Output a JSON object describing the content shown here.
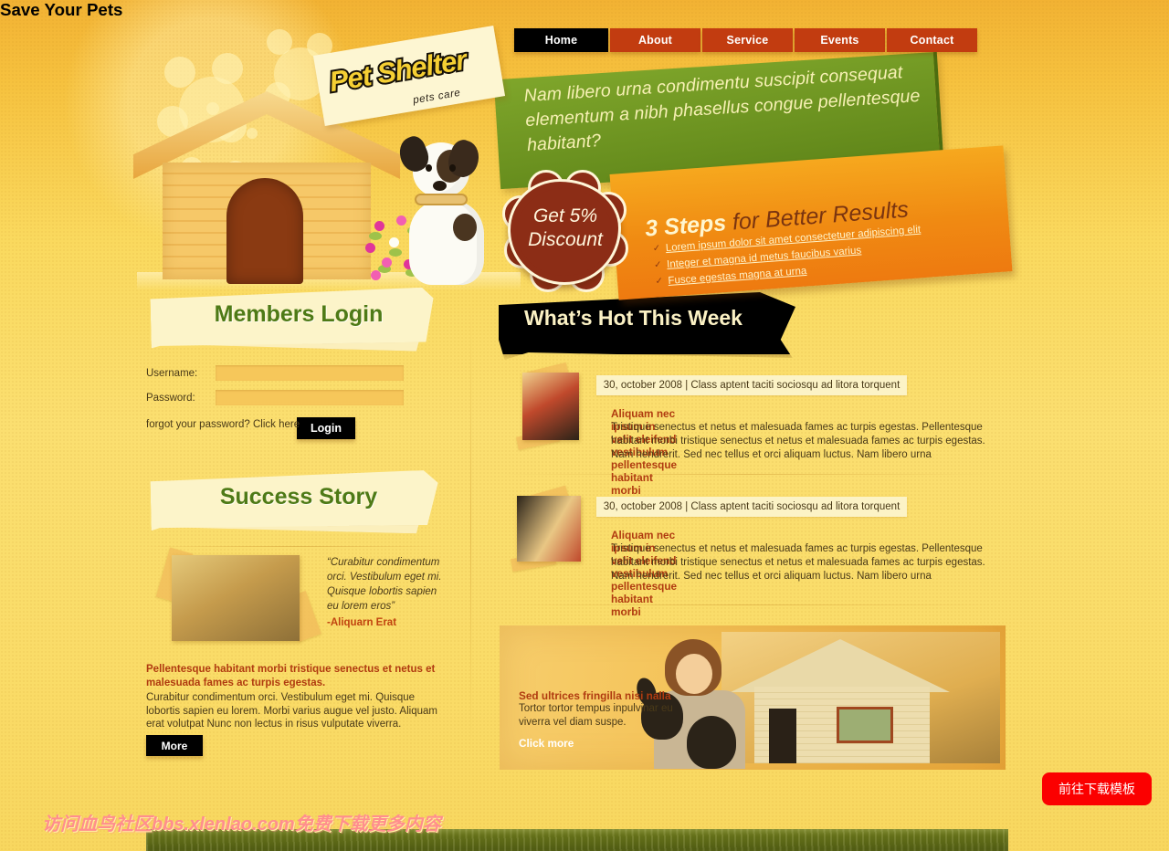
{
  "site": {
    "logo_title": "Pet Shelter",
    "logo_tagline": "pets care"
  },
  "nav": {
    "items": [
      {
        "label": "Home",
        "active": true
      },
      {
        "label": "About",
        "active": false
      },
      {
        "label": "Service",
        "active": false
      },
      {
        "label": "Events",
        "active": false
      },
      {
        "label": "Contact",
        "active": false
      }
    ]
  },
  "hero": {
    "green_banner_text": "Nam libero urna condimentu suscipit consequat elementum a nibh phasellus congue pellentesque habitant?",
    "badge_line1": "Get 5%",
    "badge_line2": "Discount",
    "steps_title_bold": "3 Steps",
    "steps_title_light": " for Better Results",
    "steps_links": [
      "Lorem ipsum dolor sit amet consectetuer adipiscing elit",
      "Integer et magna id metus faucibus varius",
      "Fusce egestas magna at urna"
    ]
  },
  "login": {
    "heading": "Members Login",
    "username_label": "Username:",
    "username_value": "",
    "username_placeholder": "",
    "password_label": "Password:",
    "password_value": "",
    "password_placeholder": "",
    "forgot_text": "forgot your password? Click here",
    "button_label": "Login"
  },
  "success_story": {
    "heading": "Success Story",
    "quote": "“Curabitur condimentum orci. Vestibulum eget mi. Quisque lobortis sapien eu lorem eros”",
    "author": "-Aliquarn Erat",
    "body_lead": "Pellentesque habitant morbi tristique senectus et netus et malesuada fames ac turpis egestas.",
    "body_text": "Curabitur condimentum orci. Vestibulum eget mi. Quisque lobortis sapien eu lorem. Morbi varius augue vel justo. Aliquam erat volutpat Nunc non lectus in risus vulputate viverra.",
    "more_label": "More"
  },
  "whats_hot": {
    "heading": "What’s Hot This Week",
    "items": [
      {
        "date": "30, october 2008 | Class aptent taciti sociosqu ad litora torquent",
        "title": "Aliquam nec ipsum in velit eleifend vestibulum pellentesque habitant morbi",
        "body": "Tristique senectus et netus et malesuada fames ac turpis egestas. Pellentesque habitant morbi tristique senectus et netus et malesuada fames ac turpis egestas. Nam hendrerit. Sed nec tellus et orci aliquam luctus. Nam libero urna"
      },
      {
        "date": "30, october 2008 | Class aptent taciti sociosqu ad litora torquent",
        "title": "Aliquam nec ipsum in velit eleifend vestibulum pellentesque habitant morbi",
        "body": "Tristique senectus et netus et malesuada fames ac turpis egestas. Pellentesque habitant morbi tristique senectus et netus et malesuada fames ac turpis egestas. Nam hendrerit. Sed nec tellus et orci aliquam luctus. Nam libero urna"
      }
    ]
  },
  "save_pets": {
    "heading": "Save Your Pets",
    "subheading": "Sed ultrices fringilla nisi nalla",
    "body": "Tortor tortor tempus inpulvinar eu viverra vel diam suspe.",
    "link_label": "Click more"
  },
  "overlay": {
    "watermark": "访问血鸟社区bbs.xlenlao.com免费下载更多内容",
    "download_button": "前往下载模板"
  },
  "colors": {
    "page_bg": "#FADC68",
    "nav_item": "#C23C10",
    "nav_active": "#000000",
    "green_banner": "#6E9620",
    "orange_banner": "#F08A12",
    "badge": "#8C2D16",
    "heading_green": "#4E7A16",
    "accent_red": "#B03B10",
    "watermark_pink": "#FF8E8E",
    "download_red": "#FB0000",
    "footer_green": "#5A6614"
  }
}
